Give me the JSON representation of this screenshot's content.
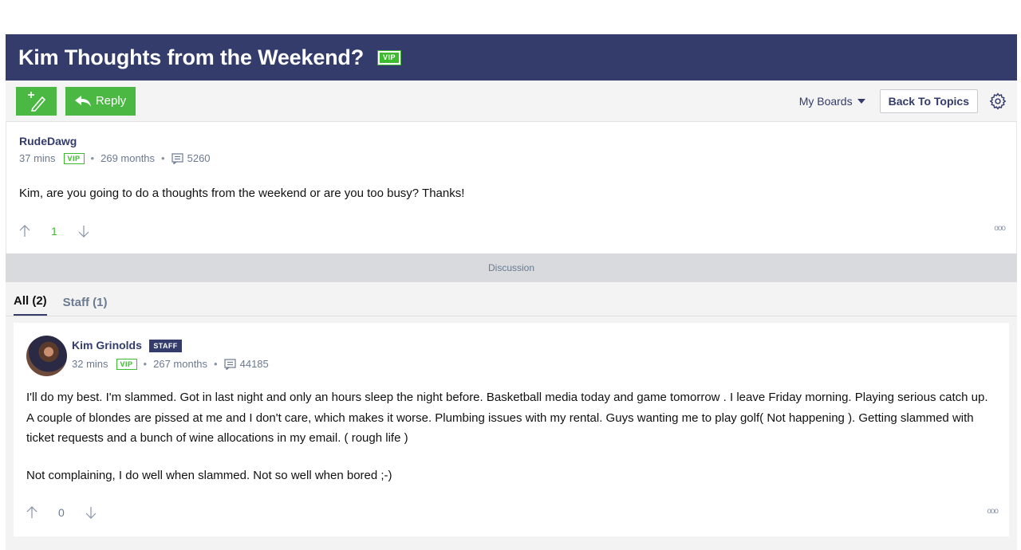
{
  "thread": {
    "title": "Kim Thoughts from the Weekend?",
    "title_badge": "VIP"
  },
  "toolbar": {
    "new_topic_icon": "pencil-plus-icon",
    "reply_label": "Reply",
    "my_boards_label": "My Boards",
    "back_label": "Back To Topics",
    "settings_icon": "gear-icon"
  },
  "original_post": {
    "author": "RudeDawg",
    "time": "37 mins",
    "badge": "VIP",
    "tenure": "269 months",
    "post_count": "5260",
    "body": "Kim, are you going to do a thoughts from the weekend or are you too busy? Thanks!",
    "votes": "1",
    "more": "ooo"
  },
  "discussion_label": "Discussion",
  "tabs": [
    {
      "label": "All (2)",
      "active": true
    },
    {
      "label": "Staff (1)",
      "active": false
    }
  ],
  "reply_post": {
    "author": "Kim Grinolds",
    "role_badge": "STAFF",
    "time": "32 mins",
    "badge": "VIP",
    "tenure": "267 months",
    "post_count": "44185",
    "body_p1": "I'll do my best. I'm slammed. Got in last night and only an hours sleep the night before. Basketball media today and game tomorrow . I leave Friday morning. Playing serious catch up. A couple of blondes are pissed at me and I don't care, which makes it worse. Plumbing issues with my rental. Guys wanting me to play golf( Not happening ). Getting slammed with ticket requests and a bunch of wine allocations in my email. ( rough life )",
    "body_p2": "Not complaining, I do well when slammed. Not so well when bored ;-)",
    "votes": "0",
    "more": "ooo"
  },
  "colors": {
    "header_bg": "#333c6b",
    "accent_green": "#4bb843",
    "vip_green": "#3dbb2f"
  }
}
